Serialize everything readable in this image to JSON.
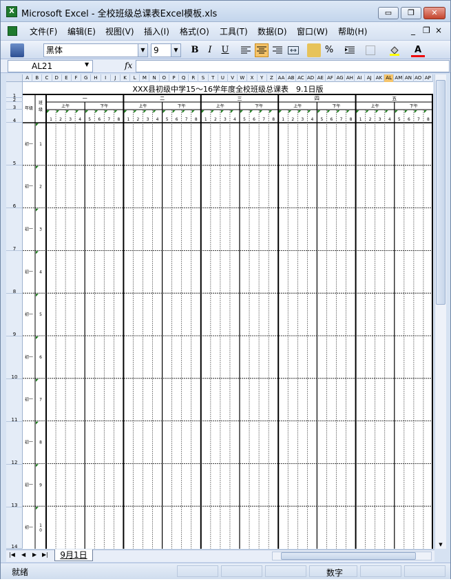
{
  "window": {
    "app_icon": "X",
    "title": "Microsoft Excel - 全校班级总课表Excel模板.xls",
    "min_glyph": "▭",
    "restore_glyph": "❐",
    "close_glyph": "✕"
  },
  "menu": [
    "文件(F)",
    "编辑(E)",
    "视图(V)",
    "插入(I)",
    "格式(O)",
    "工具(T)",
    "数据(D)",
    "窗口(W)",
    "帮助(H)"
  ],
  "mdi": {
    "min": "_",
    "restore": "❐",
    "close": "×"
  },
  "toolbar": {
    "font": "黑体",
    "size": "9",
    "bold": "B",
    "italic": "I",
    "underline": "U",
    "percent": "%",
    "font_color_glyph": "A",
    "arrow": "▼"
  },
  "formula": {
    "name_box": "AL21",
    "fx": "fx",
    "value": ""
  },
  "columns": [
    "A",
    "B",
    "C",
    "D",
    "E",
    "F",
    "G",
    "H",
    "I",
    "J",
    "K",
    "L",
    "M",
    "N",
    "O",
    "P",
    "Q",
    "R",
    "S",
    "T",
    "U",
    "V",
    "W",
    "X",
    "Y",
    "Z",
    "AA",
    "AB",
    "AC",
    "AD",
    "AE",
    "AF",
    "AG",
    "AH",
    "AI",
    "AJ",
    "AK",
    "AL",
    "AM",
    "AN",
    "AO",
    "AP"
  ],
  "selected_column": "AL",
  "rows": [
    "1",
    "2",
    "3",
    "4",
    "5",
    "6",
    "7",
    "8",
    "9",
    "10",
    "11",
    "12",
    "13",
    "14"
  ],
  "sheet": {
    "title": "XXX县初级中学15～16学年度全校班级总课表　9.1日版",
    "grade_header": "年级",
    "class_header": "班级",
    "days": [
      "一",
      "二",
      "三",
      "四",
      "五"
    ],
    "am": "上午",
    "pm": "下午",
    "periods": [
      "1",
      "2",
      "3",
      "4",
      "5",
      "6",
      "7",
      "8"
    ],
    "grade": "初一",
    "classes": [
      "1",
      "2",
      "3",
      "4",
      "5",
      "6",
      "7",
      "8",
      "9",
      "10"
    ]
  },
  "tabs": {
    "first": "|◀",
    "prev": "◀",
    "next": "▶",
    "last": "▶|",
    "active": "9月1日"
  },
  "status": {
    "ready": "就绪",
    "numlock": "数字"
  },
  "accent": "#f5c46a"
}
